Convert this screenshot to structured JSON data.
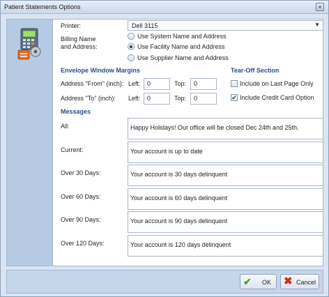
{
  "window": {
    "title": "Patient Statements Options",
    "close_glyph": "×"
  },
  "printer": {
    "label": "Printer:",
    "value": "Dell 3115"
  },
  "billing": {
    "label_line1": "Billing Name",
    "label_line2": "and Address:",
    "options": [
      {
        "label": "Use System Name and Address",
        "selected": false
      },
      {
        "label": "Use Facility Name and Address",
        "selected": true
      },
      {
        "label": "Use Supplier Name and Address",
        "selected": false
      }
    ]
  },
  "margins": {
    "heading": "Envelope Window Margins",
    "from_label": "Address \"From\" (inch):",
    "to_label": "Address \"To\" (inch):",
    "left_label": "Left:",
    "top_label": "Top:",
    "from_left": "0",
    "from_top": "0",
    "to_left": "0",
    "to_top": "0"
  },
  "tearoff": {
    "heading": "Tear-Off Section",
    "last_page_label": "Include on Last Page Only",
    "last_page_checked": false,
    "credit_card_label": "Include Credit Card Option",
    "credit_card_checked": true
  },
  "messages": {
    "heading": "Messages",
    "items": [
      {
        "label": "All:",
        "text": "Happy Holidays! Our office will be closed Dec 24th and 25th."
      },
      {
        "label": "Current:",
        "text": "Your account is up to date"
      },
      {
        "label": "Over 30 Days:",
        "text": "Your account is 30 days delinquent"
      },
      {
        "label": "Over 60 Days:",
        "text": "Your account is 60 days delinquent"
      },
      {
        "label": "Over 90 Days:",
        "text": "Your account is 90 days delinquent"
      },
      {
        "label": "Over 120 Days:",
        "text": "Your account is 120 days delinquent"
      }
    ]
  },
  "buttons": {
    "ok": "OK",
    "cancel": "Cancel"
  },
  "icons": {
    "sidebar": "printer-settings-icon",
    "ok": "checkmark-icon",
    "cancel": "x-icon",
    "dropdown": "chevron-down-icon"
  },
  "colors": {
    "heading": "#2a4d8f",
    "sidebar": "#b7cae3",
    "ok_icon": "#4e9d1f",
    "cancel_icon": "#d42a1e"
  }
}
